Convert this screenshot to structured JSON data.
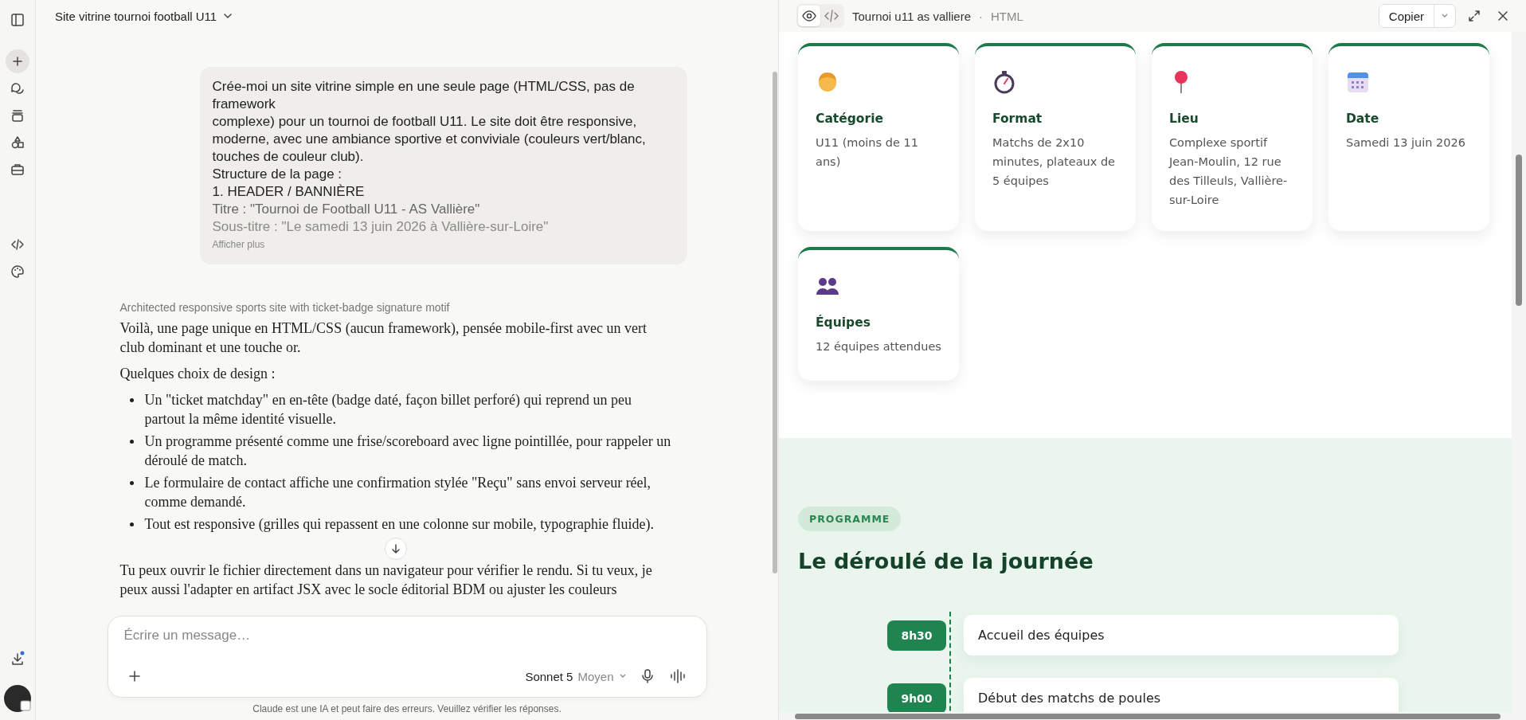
{
  "chat": {
    "title": "Site vitrine tournoi football U11",
    "user_message": {
      "lines": [
        "Crée-moi un site vitrine simple en une seule page (HTML/CSS, pas de framework",
        "complexe) pour un tournoi de football U11. Le site doit être responsive, moderne, avec une ambiance sportive et conviviale (couleurs vert/blanc, touches de couleur club).",
        "Structure de la page :",
        "1. HEADER / BANNIÈRE",
        "Titre : \"Tournoi de Football U11 - AS Vallière\"",
        "Sous-titre : \"Le samedi 13 juin 2026 à Vallière-sur-Loire\""
      ],
      "show_more": "Afficher plus"
    },
    "thinking_summary": "Architected responsive sports site with ticket-badge signature motif",
    "reply": {
      "intro": "Voilà, une page unique en HTML/CSS (aucun framework), pensée mobile-first avec un vert club dominant et une touche or.",
      "lead": "Quelques choix de design :",
      "bullets": [
        "Un \"ticket matchday\" en en-tête (badge daté, façon billet perforé) qui reprend un peu partout la même identité visuelle.",
        "Un programme présenté comme une frise/scoreboard avec ligne pointillée, pour rappeler un déroulé de match.",
        "Le formulaire de contact affiche une confirmation stylée \"Reçu\" sans envoi serveur réel, comme demandé.",
        "Tout est responsive (grilles qui repassent en une colonne sur mobile, typographie fluide)."
      ],
      "closing": "Tu peux ouvrir le fichier directement dans un navigateur pour vérifier le rendu. Si tu veux, je peux aussi l'adapter en artifact JSX avec le socle éditorial BDM ou ajuster les couleurs"
    },
    "composer": {
      "placeholder": "Écrire un message…",
      "model": "Sonnet 5",
      "effort": "Moyen"
    },
    "disclaimer": "Claude est une IA et peut faire des erreurs. Veuillez vérifier les réponses."
  },
  "artifact": {
    "view_toggle": [
      {
        "selected": true
      },
      {
        "selected": false
      }
    ],
    "title": "Tournoi u11 as valliere",
    "separator": "·",
    "type": "HTML",
    "copy_label": "Copier",
    "info_cards": [
      {
        "title": "Catégorie",
        "text": "U11 (moins de 11 ans)"
      },
      {
        "title": "Format",
        "text": "Matchs de 2x10 minutes, plateaux de 5 équipes"
      },
      {
        "title": "Lieu",
        "text": "Complexe sportif Jean-Moulin, 12 rue des Tilleuls, Vallière-sur-Loire"
      },
      {
        "title": "Date",
        "text": "Samedi 13 juin 2026"
      },
      {
        "title": "Équipes",
        "text": "12 équipes attendues"
      }
    ],
    "program": {
      "tag": "PROGRAMME",
      "heading": "Le déroulé de la journée",
      "schedule": [
        {
          "time": "8h30",
          "label": "Accueil des équipes"
        },
        {
          "time": "9h00",
          "label": "Début des matchs de poules"
        }
      ]
    }
  }
}
